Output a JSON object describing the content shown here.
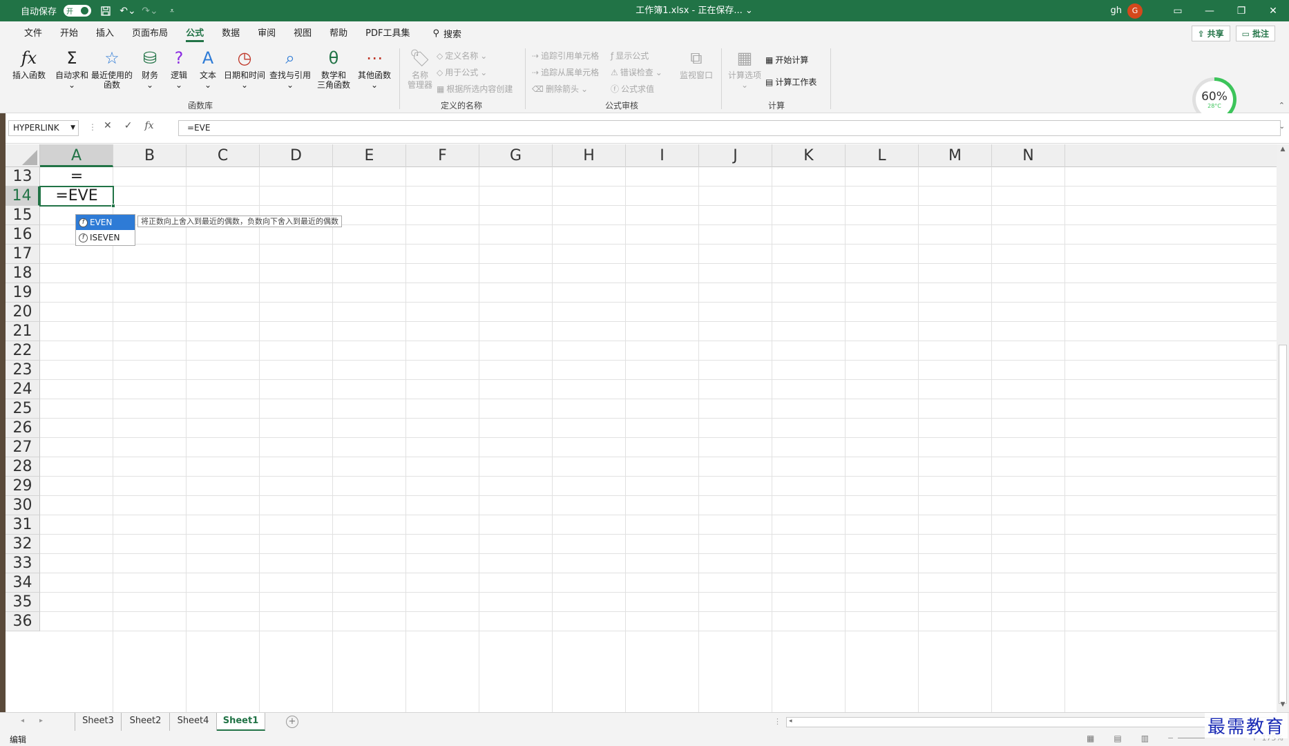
{
  "titlebar": {
    "autosave_label": "自动保存",
    "autosave_state": "开",
    "doc_title": "工作簿1.xlsx - 正在保存... ⌄",
    "user": "gh",
    "avatar_initial": "G"
  },
  "menu": {
    "items": [
      "文件",
      "开始",
      "插入",
      "页面布局",
      "公式",
      "数据",
      "审阅",
      "视图",
      "帮助",
      "PDF工具集"
    ],
    "active_index": 4,
    "search_label": "搜索",
    "share_label": "共享",
    "comment_label": "批注"
  },
  "ribbon": {
    "function_library": {
      "label": "函数库",
      "insert_function": "插入函数",
      "autosum": "自动求和",
      "recent_line1": "最近使用的",
      "recent_line2": "函数",
      "financial": "财务",
      "logical": "逻辑",
      "text": "文本",
      "datetime": "日期和时间",
      "lookup": "查找与引用",
      "math_line1": "数学和",
      "math_line2": "三角函数",
      "more": "其他函数"
    },
    "defined_names": {
      "label": "定义的名称",
      "name_manager_line1": "名称",
      "name_manager_line2": "管理器",
      "define_name": "定义名称",
      "use_in_formula": "用于公式",
      "create_from_selection": "根据所选内容创建"
    },
    "formula_auditing": {
      "label": "公式审核",
      "trace_precedents": "追踪引用单元格",
      "trace_dependents": "追踪从属单元格",
      "remove_arrows": "删除箭头",
      "show_formulas": "显示公式",
      "error_checking": "错误检查",
      "evaluate_formula": "公式求值",
      "watch_window": "监视窗口"
    },
    "calculation": {
      "label": "计算",
      "options": "计算选项",
      "calc_now": "开始计算",
      "calc_sheet": "计算工作表"
    }
  },
  "gauge": {
    "percent": "60%",
    "percent_value": 60,
    "temp": "28°C"
  },
  "formula_bar": {
    "name_box": "HYPERLINK",
    "formula": "=EVE"
  },
  "grid": {
    "columns": [
      "A",
      "B",
      "C",
      "D",
      "E",
      "F",
      "G",
      "H",
      "I",
      "J",
      "K",
      "L",
      "M",
      "N"
    ],
    "selected_column": "A",
    "rows": [
      "13",
      "14",
      "15",
      "16",
      "17",
      "18",
      "19",
      "20",
      "21",
      "22",
      "23",
      "24",
      "25",
      "26",
      "27",
      "28",
      "29",
      "30",
      "31",
      "32",
      "33",
      "34",
      "35",
      "36"
    ],
    "selected_row": "14",
    "cell_A13": "=",
    "cell_A14": "=EVE"
  },
  "autocomplete": {
    "items": [
      "EVEN",
      "ISEVEN"
    ],
    "selected_index": 0,
    "tooltip": "将正数向上舍入到最近的偶数，负数向下舍入到最近的偶数"
  },
  "sheets": {
    "tabs": [
      "Sheet3",
      "Sheet2",
      "Sheet4",
      "Sheet1"
    ],
    "active": "Sheet1"
  },
  "status": {
    "mode": "编辑",
    "zoom": "175%"
  },
  "watermark": "最需教育",
  "colors": {
    "excel_green": "#217346",
    "autocomplete_highlight": "#2e7bd6",
    "gauge_green": "#3cc45a",
    "avatar": "#d4481c",
    "watermark": "#1a2bb5"
  }
}
